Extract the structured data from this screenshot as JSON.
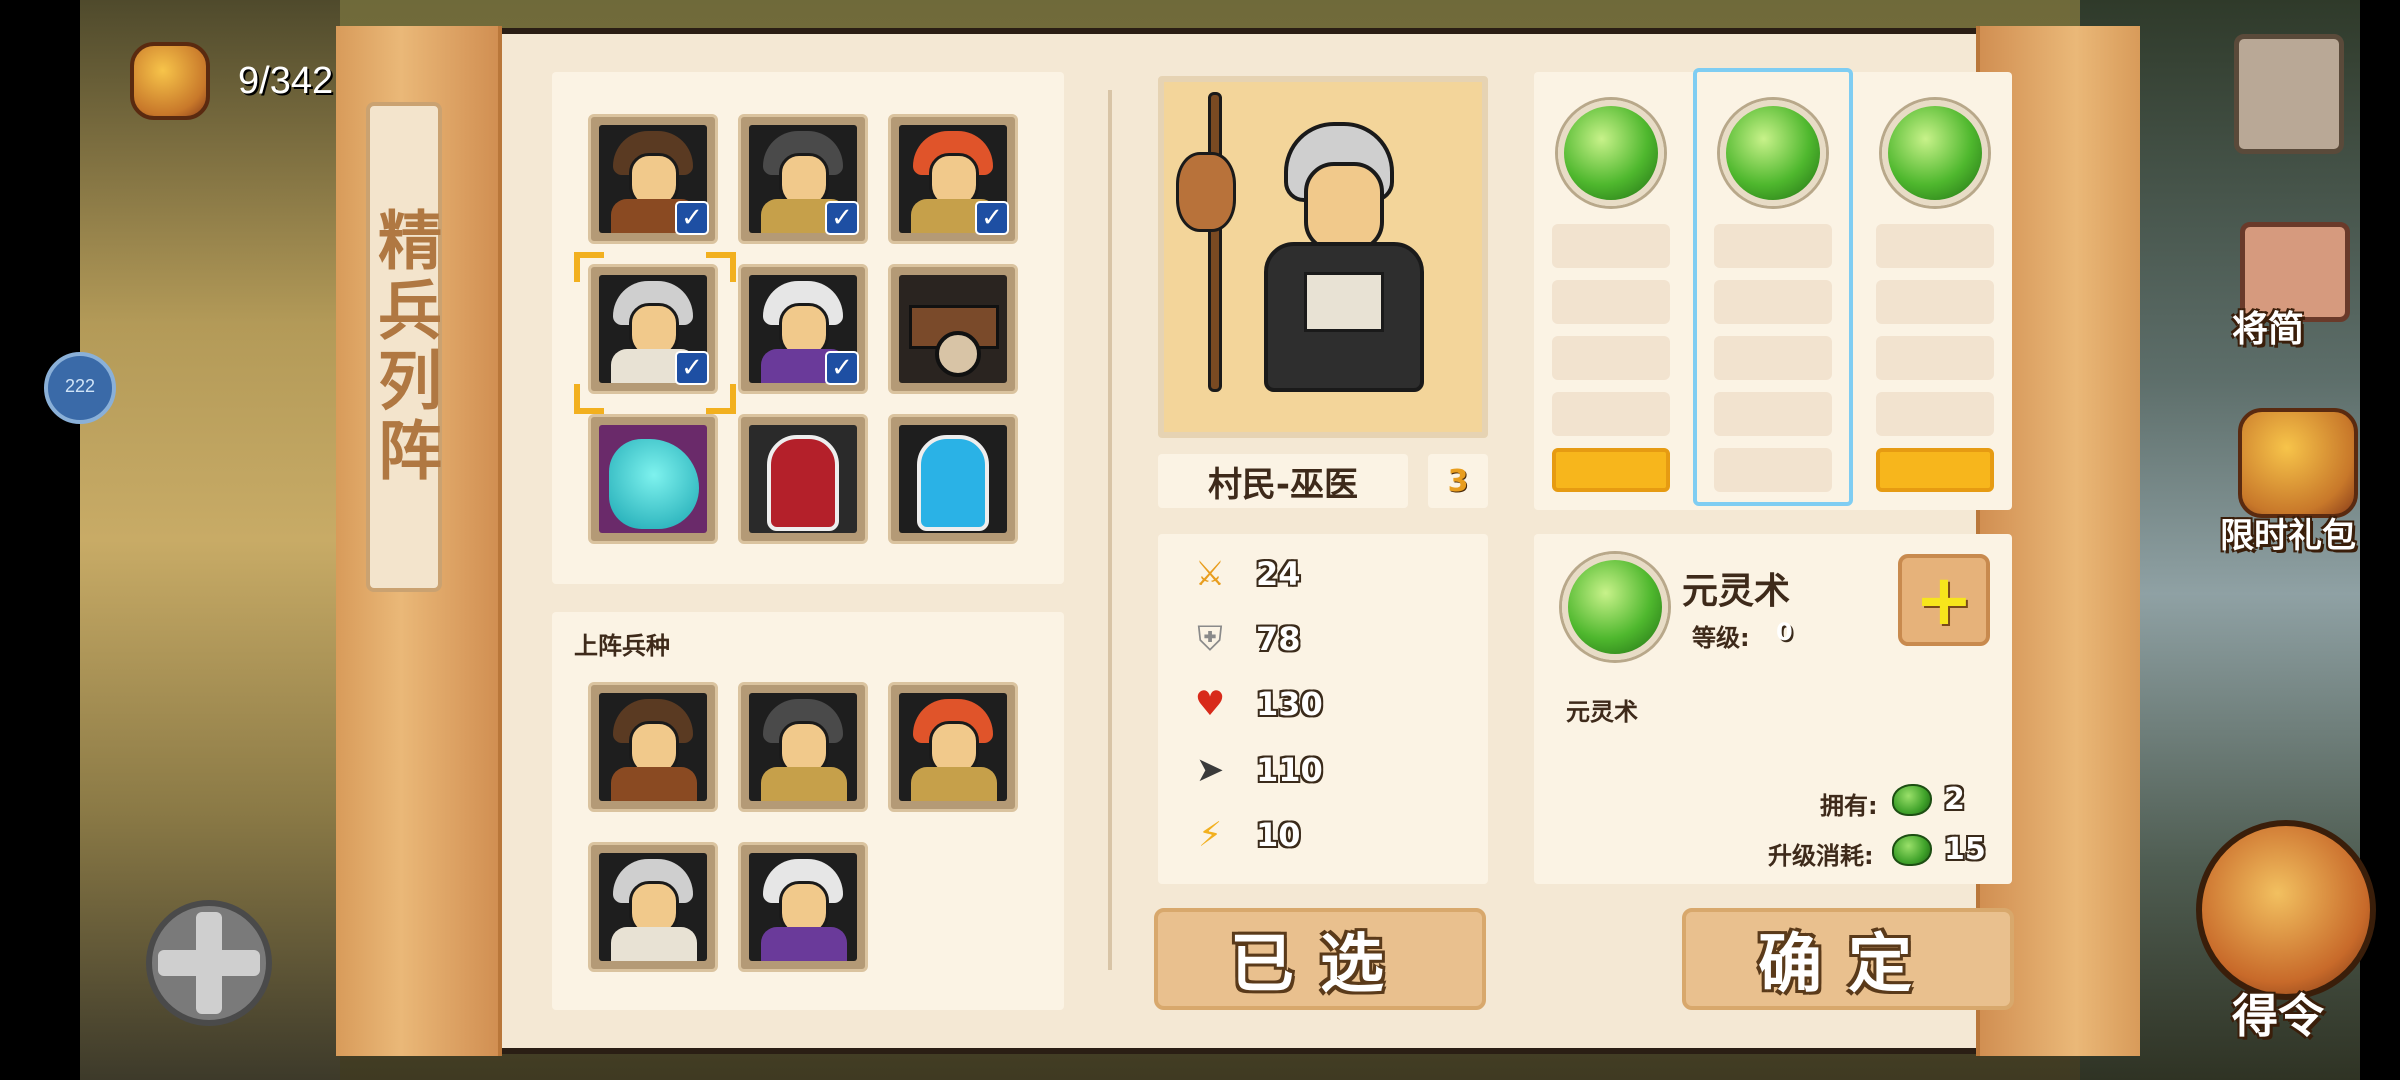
{
  "hud": {
    "counter": "9/342",
    "left_badge_number": "222"
  },
  "side_buttons": {
    "general_book": "将简",
    "limited_gift": "限时礼包",
    "get_order": "得令"
  },
  "panel": {
    "title": "精兵列阵",
    "roster_section": "上阵兵种",
    "roster": [
      {
        "id": "warrior-brown",
        "checked": true
      },
      {
        "id": "warrior-grey",
        "checked": true
      },
      {
        "id": "warrior-red",
        "checked": true
      },
      {
        "id": "shaman-old",
        "checked": true,
        "selected": true
      },
      {
        "id": "mage-purple",
        "checked": true
      },
      {
        "id": "chariot",
        "checked": false
      },
      {
        "id": "dragon-blue",
        "checked": false
      },
      {
        "id": "knight-red",
        "checked": false
      },
      {
        "id": "knight-blue",
        "checked": false
      }
    ],
    "deployed": [
      "warrior-brown",
      "warrior-grey",
      "warrior-red",
      "shaman-old",
      "mage-purple"
    ]
  },
  "unit": {
    "name": "村民-巫医",
    "level": "3",
    "stats": {
      "attack": "24",
      "defense": "78",
      "hp": "130",
      "speed": "110",
      "energy": "10"
    }
  },
  "skill": {
    "name": "元灵术",
    "level_label": "等级:",
    "level": "0",
    "description": "元灵术",
    "own_label": "拥有:",
    "own": "2",
    "cost_label": "升级消耗:",
    "cost": "15"
  },
  "buttons": {
    "selected": "已选",
    "confirm": "确定"
  }
}
